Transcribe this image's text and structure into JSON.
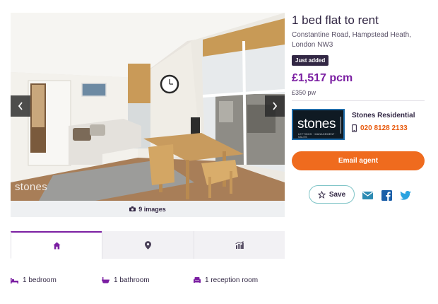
{
  "gallery": {
    "watermark": "stones",
    "image_count_label": "9 images",
    "prev_icon": "chevron-left-icon",
    "next_icon": "chevron-right-icon"
  },
  "listing": {
    "title": "1 bed flat to rent",
    "address": "Constantine Road, Hampstead Heath, London NW3",
    "badge": "Just added",
    "price": "£1,517 pcm",
    "price_weekly": "£350 pw"
  },
  "agent": {
    "logo_word": "stones",
    "logo_tag": "LETTINGS · MANAGEMENT · SALES",
    "name": "Stones Residential",
    "phone": "020 8128 2133",
    "phone_icon": "mobile-phone-icon"
  },
  "actions": {
    "email_label": "Email agent",
    "save_label": "Save",
    "share_icons": [
      "email-icon",
      "facebook-icon",
      "twitter-icon"
    ]
  },
  "tabs": [
    {
      "icon": "home-icon",
      "active": true
    },
    {
      "icon": "map-pin-icon",
      "active": false
    },
    {
      "icon": "chart-icon",
      "active": false
    }
  ],
  "features": {
    "bedrooms": "1 bedroom",
    "bathrooms": "1 bathroom",
    "reception": "1 reception room"
  },
  "colors": {
    "primary_text": "#322744",
    "price": "#7b1fa2",
    "accent_orange": "#ef6b1e",
    "phone": "#e8590c",
    "badge_bg": "#322744",
    "save_border": "#7fc4c7",
    "email_share": "#2d8bb3",
    "facebook": "#1b5fa8",
    "twitter": "#2aa3e0",
    "feature_icon": "#7b1fa2"
  }
}
